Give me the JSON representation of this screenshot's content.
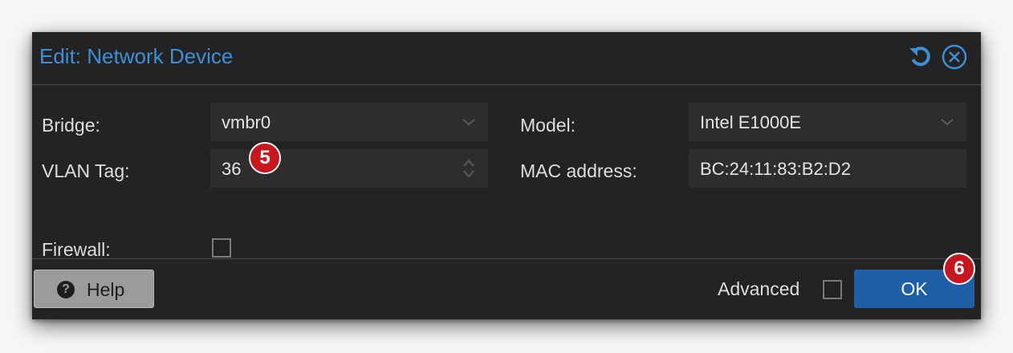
{
  "dialog": {
    "title": "Edit: Network Device",
    "icons": {
      "reset": "reset-icon",
      "close": "close-icon"
    },
    "accent_color": "#3d8fd8"
  },
  "fields": {
    "bridge": {
      "label": "Bridge:",
      "value": "vmbr0"
    },
    "vlan_tag": {
      "label": "VLAN Tag:",
      "value": "36"
    },
    "firewall": {
      "label": "Firewall:",
      "checked": false
    },
    "model": {
      "label": "Model:",
      "value": "Intel E1000E"
    },
    "mac_address": {
      "label": "MAC address:",
      "value": "BC:24:11:83:B2:D2"
    }
  },
  "footer": {
    "help_label": "Help",
    "advanced_label": "Advanced",
    "advanced_checked": false,
    "ok_label": "OK",
    "ok_color": "#1e5fa8"
  },
  "annotations": {
    "badge_vlan": "5",
    "badge_ok": "6",
    "badge_color": "#c7161d"
  }
}
